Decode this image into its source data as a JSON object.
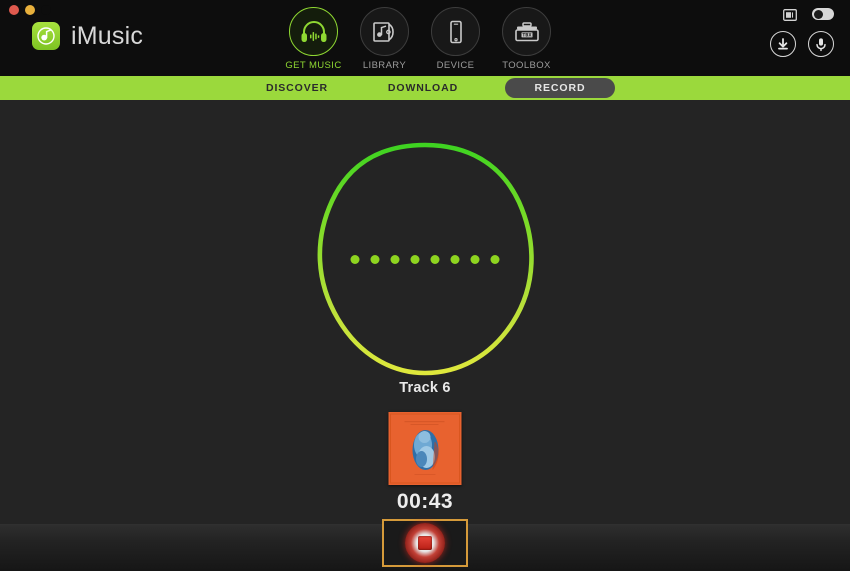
{
  "window": {
    "traffic_lights": [
      "close",
      "minimize",
      "zoom"
    ]
  },
  "brand": {
    "name": "iMusic",
    "logo_icon": "music-note-icon"
  },
  "main_nav": {
    "items": [
      {
        "label": "GET MUSIC",
        "icon": "headphones-icon",
        "active": true
      },
      {
        "label": "LIBRARY",
        "icon": "cd-case-icon",
        "active": false
      },
      {
        "label": "DEVICE",
        "icon": "phone-icon",
        "active": false
      },
      {
        "label": "TOOLBOX",
        "icon": "toolbox-icon",
        "active": false
      }
    ]
  },
  "top_right": {
    "feedback_icon": "feedback-window-icon",
    "toggle_icon": "toggle-switch",
    "download_icon": "download-arrow-icon",
    "record_icon": "microphone-icon"
  },
  "sub_nav": {
    "items": [
      {
        "label": "DISCOVER",
        "active": false
      },
      {
        "label": "DOWNLOAD",
        "active": false
      },
      {
        "label": "RECORD",
        "active": true
      }
    ]
  },
  "recording": {
    "visualizer_dots": 8,
    "track_title": "Track 6",
    "elapsed_time": "00:43",
    "artwork_alt": "album-artwork",
    "record_button_icon": "stop-square-icon"
  },
  "colors": {
    "accent_green": "#9bd93c",
    "nav_active_green": "#8fd832",
    "background": "#242424",
    "header": "#0d0d0d",
    "record_red": "#c8281e",
    "highlight_border": "#d59a3a"
  }
}
